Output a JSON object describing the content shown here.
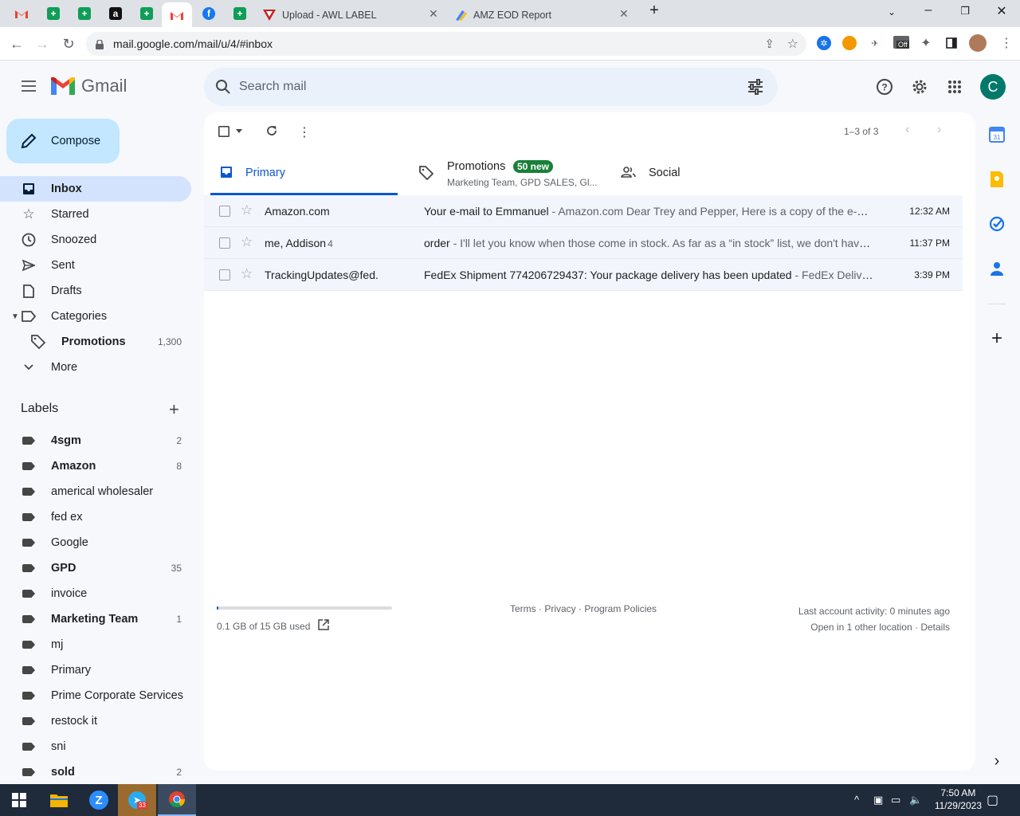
{
  "browser": {
    "tabs": [
      {
        "title": "Upload - AWL LABEL",
        "icon": "awl-label-icon"
      },
      {
        "title": "AMZ EOD Report",
        "icon": "amz-eod-icon"
      }
    ],
    "url": "mail.google.com/mail/u/4/#inbox",
    "new_tab_label": "+",
    "ext_off_label": "Off"
  },
  "gmail": {
    "logo_text": "Gmail",
    "search_placeholder": "Search mail",
    "avatar_letter": "C",
    "compose_label": "Compose",
    "nav": [
      {
        "label": "Inbox",
        "icon": "inbox-icon"
      },
      {
        "label": "Starred",
        "icon": "star-icon"
      },
      {
        "label": "Snoozed",
        "icon": "clock-icon"
      },
      {
        "label": "Sent",
        "icon": "send-icon"
      },
      {
        "label": "Drafts",
        "icon": "draft-icon"
      },
      {
        "label": "Categories",
        "icon": "label-outline-icon"
      },
      {
        "label": "Promotions",
        "icon": "tag-icon",
        "count": "1,300"
      },
      {
        "label": "More",
        "icon": "chevron-down-icon"
      }
    ],
    "labels_heading": "Labels",
    "labels": [
      {
        "name": "4sgm",
        "count": "2",
        "bold": true
      },
      {
        "name": "Amazon",
        "count": "8",
        "bold": true
      },
      {
        "name": "americal wholesaler",
        "count": "",
        "bold": false
      },
      {
        "name": "fed ex",
        "count": "",
        "bold": false
      },
      {
        "name": "Google",
        "count": "",
        "bold": false
      },
      {
        "name": "GPD",
        "count": "35",
        "bold": true
      },
      {
        "name": "invoice",
        "count": "",
        "bold": false
      },
      {
        "name": "Marketing Team",
        "count": "1",
        "bold": true
      },
      {
        "name": "mj",
        "count": "",
        "bold": false
      },
      {
        "name": "Primary",
        "count": "",
        "bold": false
      },
      {
        "name": "Prime Corporate Services",
        "count": "",
        "bold": false
      },
      {
        "name": "restock it",
        "count": "",
        "bold": false
      },
      {
        "name": "sni",
        "count": "",
        "bold": false
      },
      {
        "name": "sold",
        "count": "2",
        "bold": true
      }
    ],
    "pager": "1–3 of 3",
    "tabs": {
      "primary": "Primary",
      "promotions": "Promotions",
      "promotions_badge": "50 new",
      "promotions_sub": "Marketing Team, GPD SALES, Gl...",
      "social": "Social"
    },
    "emails": [
      {
        "sender": "Amazon.com",
        "count": "",
        "subject": "Your e-mail to Emmanuel",
        "snippet": " - Amazon.com Dear Trey and Pepper, Here is a copy of the e-mail you sent",
        "time": "12:32 AM"
      },
      {
        "sender": "me, Addison",
        "count": "4",
        "subject": "order",
        "snippet": " - I'll let you know when those come in stock. As far as a “in stock” list, we don't have one",
        "time": "11:37 PM"
      },
      {
        "sender": "TrackingUpdates@fed.",
        "count": "",
        "subject": "FedEx Shipment 774206729437: Your package delivery has been updated",
        "snippet": " - FedEx Delivery Manager",
        "time": "3:39 PM"
      }
    ],
    "storage_used_fraction": 0.007,
    "footer": {
      "storage": "0.1 GB of 15 GB used",
      "links": "Terms · Privacy · Program Policies",
      "activity": "Last account activity: 0 minutes ago",
      "location": "Open in 1 other location · Details"
    }
  },
  "taskbar": {
    "time": "7:50 AM",
    "date": "11/29/2023",
    "telegram_badge": "33"
  }
}
